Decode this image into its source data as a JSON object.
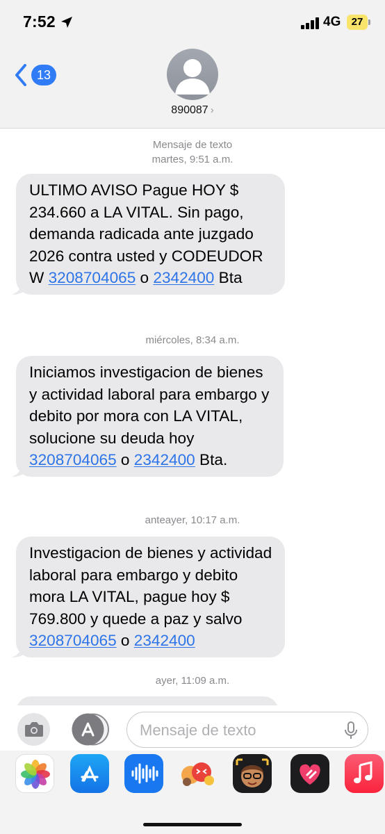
{
  "status_bar": {
    "time": "7:52",
    "network": "4G",
    "battery": "27"
  },
  "header": {
    "back_count": "13",
    "contact": "890087",
    "contact_chevron": "›"
  },
  "conversation": [
    {
      "stamp_title": "Mensaje de texto",
      "stamp_time": "martes, 9:51 a.m.",
      "message": {
        "t1": "ULTIMO AVISO Pague HOY $ 234.660 a LA VITAL. Sin pago, demanda radicada ante juzgado 2026 contra usted y CODEUDOR W ",
        "l1": "3208704065",
        "t2": " o ",
        "l2": "2342400",
        "t3": " Bta"
      }
    },
    {
      "stamp_time": "miércoles, 8:34 a.m.",
      "message": {
        "t1": "Iniciamos investigacion de bienes y actividad laboral para embargo y debito por mora con LA VITAL, solucione su deuda hoy ",
        "l1": "3208704065",
        "t2": " o ",
        "l2": "2342400",
        "t3": " Bta."
      }
    },
    {
      "stamp_time": "anteayer, 10:17 a.m.",
      "message": {
        "t1": "Investigacion de bienes y actividad laboral para embargo y debito mora LA VITAL, pague hoy $ 769.800 y quede a paz y salvo ",
        "l1": "3208704065",
        "t2": " o ",
        "l2": "2342400",
        "t3": ""
      }
    },
    {
      "stamp_time": "ayer, 11:09 a.m."
    }
  ],
  "input": {
    "placeholder": "Mensaje de texto"
  },
  "app_drawer": [
    "photos-app",
    "app-store-app",
    "audio-message-app",
    "memoji-stickers-app",
    "memoji-app",
    "digital-touch-app",
    "music-app"
  ],
  "colors": {
    "link": "#2c74e8",
    "badge": "#2f7cf6",
    "bubble": "#e9e9eb",
    "battery": "#f8e36b"
  }
}
